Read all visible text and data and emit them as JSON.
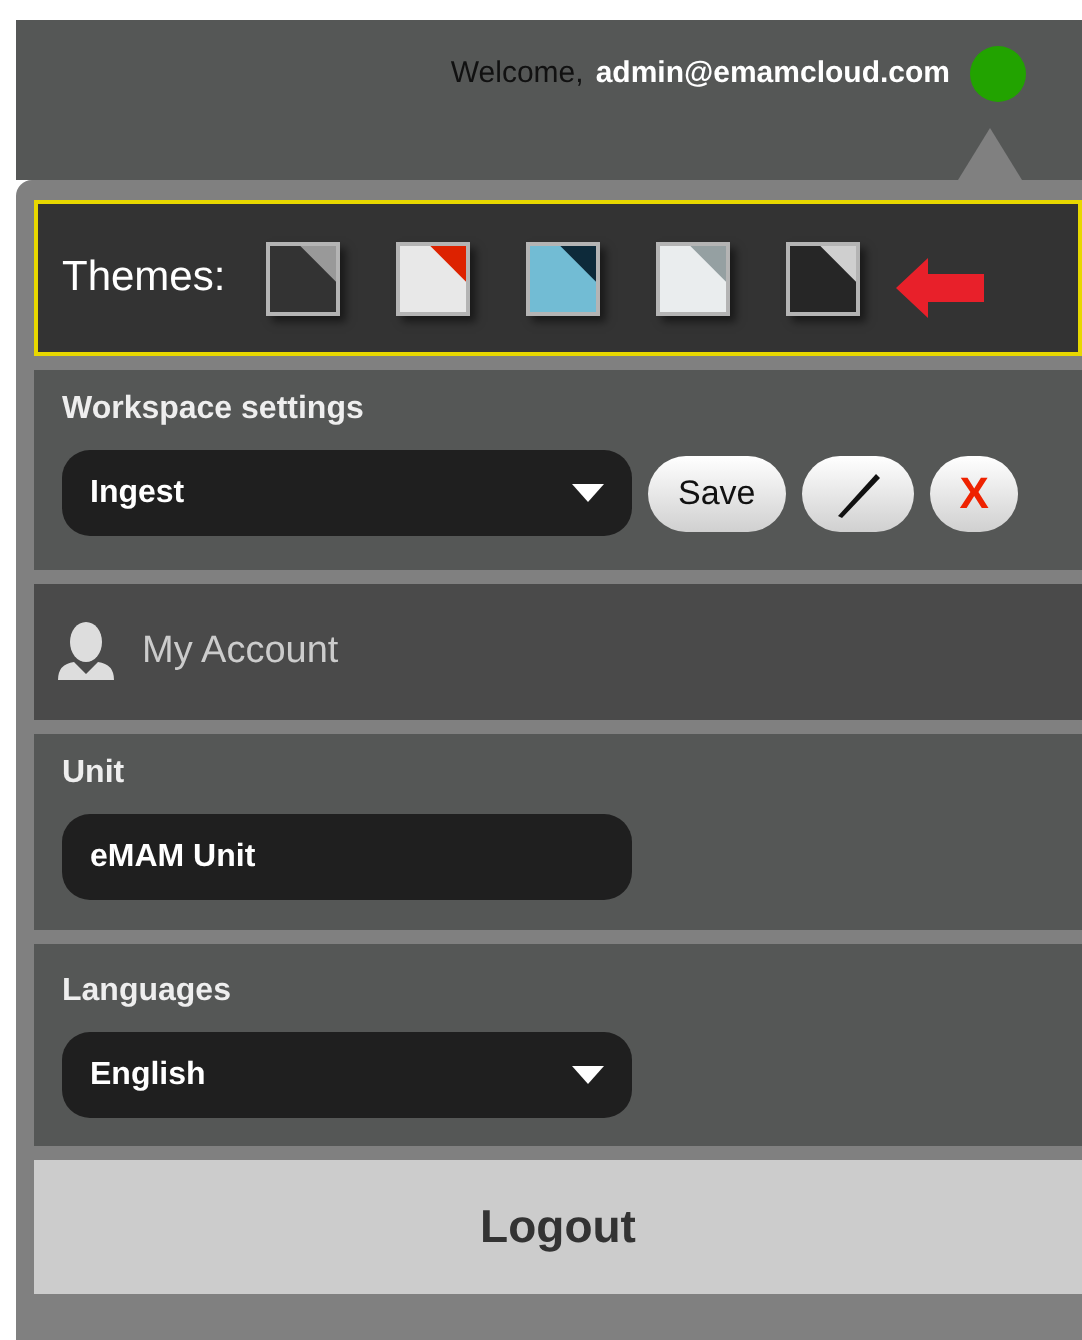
{
  "header": {
    "greeting": "Welcome,",
    "user": "admin@emamcloud.com",
    "online": true
  },
  "themes": {
    "label": "Themes:",
    "items": [
      {
        "color": "#333333",
        "corner": {
          "color": "#999999"
        }
      },
      {
        "color": "#e8e8e8",
        "corner": {
          "color": "#dd2200"
        }
      },
      {
        "color": "#72bcd4",
        "corner": {
          "color": "#0d2a3a"
        }
      },
      {
        "color": "#eaedee",
        "corner": {
          "color": "#95a0a2"
        }
      },
      {
        "color": "#262626",
        "corner": {
          "color": "#cfcfcf"
        }
      }
    ]
  },
  "workspace": {
    "label": "Workspace settings",
    "value": "Ingest",
    "buttons": [
      {
        "kind": "text",
        "label": "Save"
      },
      {
        "kind": "edit"
      },
      {
        "kind": "text",
        "label": "X",
        "danger": true
      }
    ]
  },
  "account": {
    "label": "My Account"
  },
  "unit": {
    "label": "Unit",
    "value": "eMAM Unit"
  },
  "languages": {
    "label": "Languages",
    "value": "English"
  },
  "logout": {
    "label": "Logout"
  }
}
